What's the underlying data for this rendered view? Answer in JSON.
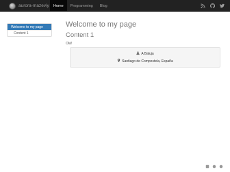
{
  "navbar": {
    "brand": "aurora-mazeviy",
    "links": [
      {
        "label": "Home",
        "active": true
      },
      {
        "label": "Programming",
        "active": false
      },
      {
        "label": "Blog",
        "active": false
      }
    ],
    "social_icons": [
      "rss-icon",
      "github-icon",
      "twitter-icon"
    ]
  },
  "sidebar": {
    "items": [
      {
        "label": "Welcome to my page",
        "active": true
      },
      {
        "label": "Content 1",
        "active": false
      }
    ]
  },
  "main": {
    "title": "Welcome to my page",
    "section_title": "Content 1",
    "greeting": "Olá!",
    "card": {
      "name": "A Baluja",
      "location": "Santiago de Compostela, España",
      "icons": [
        "user-icon",
        "map-marker-icon"
      ]
    }
  },
  "footer": {
    "icons": [
      "icon",
      "icon",
      "icon"
    ]
  },
  "colors": {
    "navbar_bg": "#222222",
    "navbar_active": "#080808",
    "sidebar_active": "#337ab7",
    "card_bg": "#f5f5f5"
  }
}
